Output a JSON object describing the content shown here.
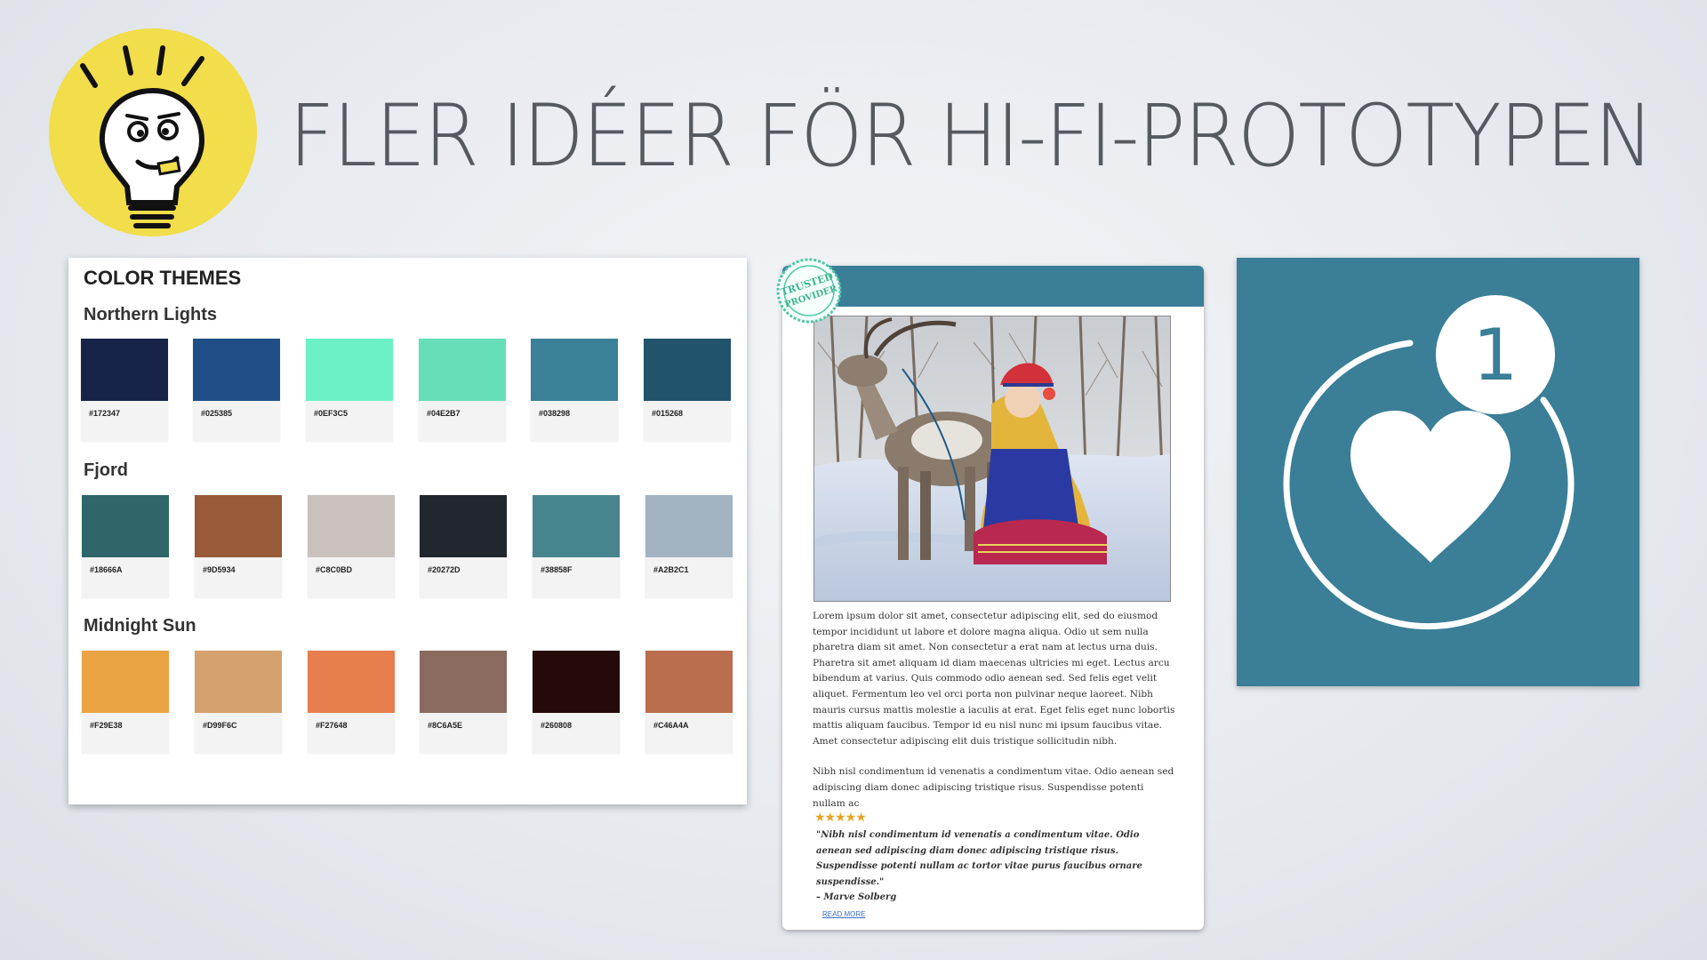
{
  "slide": {
    "title": "FLER IDÉER FÖR HI-FI-PROTOTYPEN"
  },
  "themes": {
    "heading": "COLOR THEMES",
    "groups": [
      {
        "name": "Northern Lights",
        "colors": [
          {
            "hex": "#172347",
            "color": "#172347"
          },
          {
            "hex": "#025385",
            "color": "#1f4e87"
          },
          {
            "hex": "#0EF3C5",
            "color": "#6cf1c7"
          },
          {
            "hex": "#04E2B7",
            "color": "#66dfb9"
          },
          {
            "hex": "#038298",
            "color": "#3a8099"
          },
          {
            "hex": "#015268",
            "color": "#21536a"
          }
        ]
      },
      {
        "name": "Fjord",
        "colors": [
          {
            "hex": "#18666A",
            "color": "#2e6669"
          },
          {
            "hex": "#9D5934",
            "color": "#985a37"
          },
          {
            "hex": "#C8C0BD",
            "color": "#c8c1bd"
          },
          {
            "hex": "#20272D",
            "color": "#22272d"
          },
          {
            "hex": "#38858F",
            "color": "#48848e"
          },
          {
            "hex": "#A2B2C1",
            "color": "#a3b2c1"
          }
        ]
      },
      {
        "name": "Midnight Sun",
        "colors": [
          {
            "hex": "#F29E38",
            "color": "#eaa444"
          },
          {
            "hex": "#D99F6C",
            "color": "#d4a16e"
          },
          {
            "hex": "#F27648",
            "color": "#e67e4e"
          },
          {
            "hex": "#8C6A5E",
            "color": "#8a6a5e"
          },
          {
            "hex": "#260808",
            "color": "#240a09"
          },
          {
            "hex": "#C46A4A",
            "color": "#ba6e4e"
          }
        ]
      }
    ]
  },
  "article": {
    "badge_text": "TRUSTED PROVIDER",
    "paragraph1": "Lorem ipsum dolor sit amet, consectetur adipiscing elit, sed do eiusmod tempor incididunt ut labore et dolore magna aliqua. Odio ut sem nulla pharetra diam sit amet. Non consectetur a erat nam at lectus urna duis. Pharetra sit amet aliquam id diam maecenas ultricies mi eget. Lectus arcu bibendum at varius. Quis commodo odio aenean sed. Sed felis eget velit aliquet. Fermentum leo vel orci porta non pulvinar neque laoreet. Nibh mauris cursus mattis molestie a iaculis at erat. Eget felis eget nunc lobortis mattis aliquam faucibus. Tempor id eu nisl nunc mi ipsum faucibus vitae. Amet consectetur adipiscing elit duis tristique sollicitudin nibh.",
    "paragraph2": "Nibh nisl condimentum id venenatis a condimentum vitae. Odio aenean sed adipiscing diam donec adipiscing tristique risus. Suspendisse potenti nullam ac",
    "stars": "★★★★★",
    "rating": 5,
    "quote": "\"Nibh nisl condimentum id venenatis a condimentum vitae. Odio aenean sed adipiscing diam donec adipiscing tristique risus. Suspendisse potenti nullam ac tortor vitae purus faucibus ornare suspendisse.\"",
    "author": "– Marve Solberg",
    "read_more": "READ MORE"
  },
  "like": {
    "count": "1",
    "icon": "heart-icon"
  },
  "colors": {
    "accent": "#3a7e97",
    "bulb": "#f2dd4b",
    "title": "#555a60"
  }
}
